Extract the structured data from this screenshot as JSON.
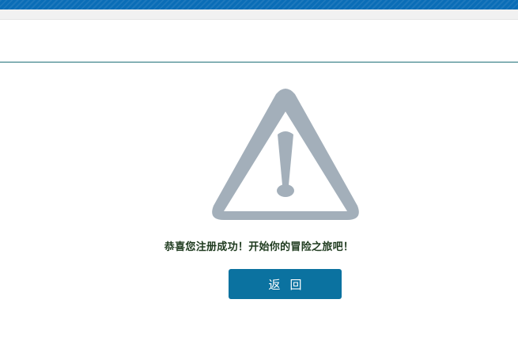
{
  "message": {
    "text": "恭喜您注册成功！开始你的冒险之旅吧！"
  },
  "actions": {
    "back_label": "返回"
  },
  "icons": {
    "alert": "warning-triangle-icon"
  },
  "colors": {
    "top_stripe": "#0a6db7",
    "header_rule": "#1f6f78",
    "icon_gray": "#a3afba",
    "button": "#0b72a0",
    "message_text": "#1e3a1e"
  }
}
